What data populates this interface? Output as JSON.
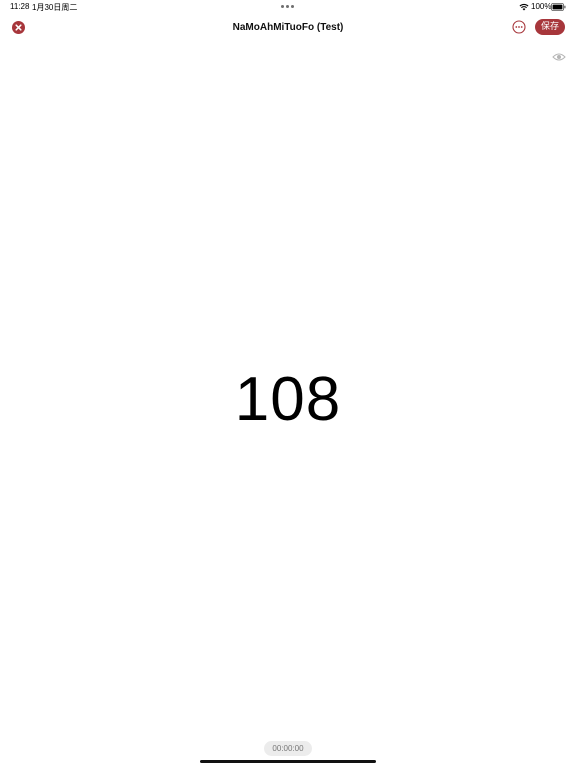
{
  "status_bar": {
    "time": "11:28",
    "date": "1月30日周二",
    "battery_percent": "100%",
    "battery_level": 1.0
  },
  "nav": {
    "title": "NaMoAhMiTuoFo (Test)",
    "save_label": "保存",
    "close_icon": "close-icon",
    "more_icon": "more-icon"
  },
  "counter": {
    "value": "108"
  },
  "timer": {
    "value": "00:00:00"
  },
  "colors": {
    "accent": "#a7363b",
    "background": "#ffffff",
    "timer_bg": "#ececec"
  }
}
